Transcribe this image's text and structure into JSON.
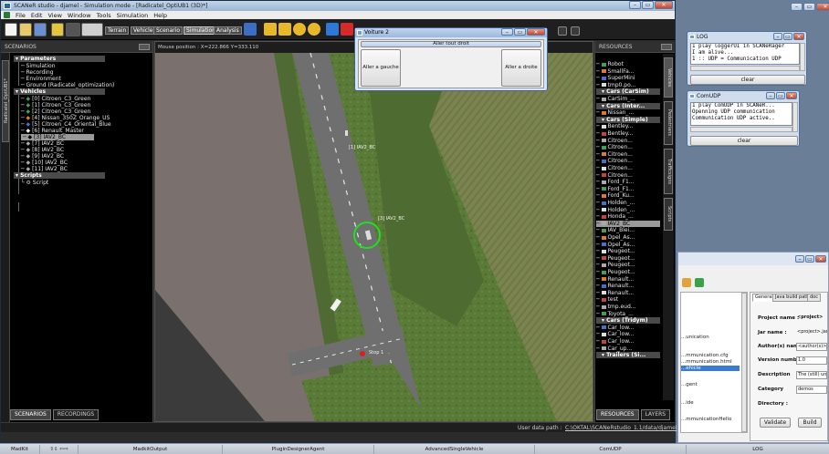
{
  "main_window": {
    "title": "SCANeR studio - djamel - Simulation mode - [Radicatel_OptiUB1 (3D)*]",
    "controls": [
      "–",
      "▭",
      "✕"
    ]
  },
  "menu": [
    "File",
    "Edit",
    "View",
    "Window",
    "Tools",
    "Simulation",
    "Help"
  ],
  "toolbar": {
    "modes": [
      "Terrain",
      "Vehicle",
      "Scenario",
      "Simulation",
      "Analysis"
    ],
    "active_mode": "Simulation"
  },
  "scenarios_panel": {
    "title": "SCENARIOS",
    "side_tab": "Radicatel_OptiUB1*",
    "tree": {
      "parameters": {
        "label": "Parameters",
        "children": [
          "Simulation",
          "Recording",
          "Environment",
          "Ground (Radicatel_optimization)"
        ]
      },
      "vehicles": {
        "label": "Vehicles",
        "children": [
          "[0] Citroen_C3_Green",
          "[1] Citroen_C3_Green",
          "[2] Citroen_C3_Green",
          "[4] Nissan_350Z_Orange_US",
          "[5] Citroen_C4_Oriental_Blue",
          "[6] Renault_Master",
          "[3] IAV2_BC",
          "[7] IAV2_BC",
          "[8] IAV2_BC",
          "[9] IAV2_BC",
          "[10] IAV2_BC",
          "[11] IAV2_BC"
        ],
        "selected": "[3] IAV2_BC"
      },
      "scripts": {
        "label": "Scripts",
        "children": [
          "Script"
        ]
      }
    },
    "bottom_tabs": [
      "SCENARIOS",
      "RECORDINGS"
    ]
  },
  "viewport": {
    "mouse_position": "Mouse position :  X=222.866    Y=333.110",
    "labels": {
      "iav2_a": "[1] IAV2_BC",
      "iav2_b": "[3] IAV2_BC",
      "stop": "Stop 1"
    }
  },
  "voiture_dialog": {
    "title": "Voiture 2",
    "btn_straight": "Aller tout droit",
    "btn_left": "Aller a gauche",
    "btn_right": "Aller a droite"
  },
  "resources_panel": {
    "title": "RESOURCES",
    "items": [
      {
        "type": "item",
        "label": "Robot"
      },
      {
        "type": "item",
        "label": "SmallFa..."
      },
      {
        "type": "item",
        "label": "SuperMini"
      },
      {
        "type": "item",
        "label": "tmp0.po..."
      },
      {
        "type": "group",
        "label": "Cars (CarSim)"
      },
      {
        "type": "item",
        "label": "CarSim_..."
      },
      {
        "type": "group",
        "label": "Cars (Inter..."
      },
      {
        "type": "item",
        "label": "Nissan_..."
      },
      {
        "type": "group",
        "label": "Cars (Simple)"
      },
      {
        "type": "item",
        "label": "Bentley..."
      },
      {
        "type": "item",
        "label": "Bentley..."
      },
      {
        "type": "item",
        "label": "Citroen..."
      },
      {
        "type": "item",
        "label": "Citroen..."
      },
      {
        "type": "item",
        "label": "Citroen..."
      },
      {
        "type": "item",
        "label": "Citroen..."
      },
      {
        "type": "item",
        "label": "Citroen..."
      },
      {
        "type": "item",
        "label": "Citroen..."
      },
      {
        "type": "item",
        "label": "Ford_F1..."
      },
      {
        "type": "item",
        "label": "Ford_F1..."
      },
      {
        "type": "item",
        "label": "Ford_Ku..."
      },
      {
        "type": "item",
        "label": "Holden_..."
      },
      {
        "type": "item",
        "label": "Holden_..."
      },
      {
        "type": "item",
        "label": "Honda_..."
      },
      {
        "type": "item",
        "label": "IAV2_BC",
        "selected": true
      },
      {
        "type": "item",
        "label": "IAV_Blei..."
      },
      {
        "type": "item",
        "label": "Opel_As..."
      },
      {
        "type": "item",
        "label": "Opel_As..."
      },
      {
        "type": "item",
        "label": "Peugeot..."
      },
      {
        "type": "item",
        "label": "Peugeot..."
      },
      {
        "type": "item",
        "label": "Peugeot..."
      },
      {
        "type": "item",
        "label": "Peugeot..."
      },
      {
        "type": "item",
        "label": "Renault..."
      },
      {
        "type": "item",
        "label": "Renault..."
      },
      {
        "type": "item",
        "label": "Renault..."
      },
      {
        "type": "item",
        "label": "test"
      },
      {
        "type": "item",
        "label": "tmp.eud..."
      },
      {
        "type": "item",
        "label": "Toyota_..."
      },
      {
        "type": "group",
        "label": "Cars (Tridym)"
      },
      {
        "type": "item",
        "label": "Car_low..."
      },
      {
        "type": "item",
        "label": "Car_low..."
      },
      {
        "type": "item",
        "label": "Car_low..."
      },
      {
        "type": "item",
        "label": "Car_up..."
      },
      {
        "type": "group",
        "label": "Trailers (Si..."
      }
    ],
    "vtabs": [
      "Vehicles",
      "Pedestrians",
      "Trafficsigns",
      "Scripts"
    ],
    "bottom_tabs": [
      "RESOURCES",
      "LAYERS"
    ]
  },
  "statusbar": {
    "label": "User data path :",
    "path": "C:\\OKTAL\\SCANeRstudio_1.1/data/djamel"
  },
  "log_window": {
    "title": "LOG",
    "lines": [
      "1 play loggerUI in SCANeRager",
      "I am alive...",
      "1 :: UDP = Communication UDP"
    ],
    "clear": "clear"
  },
  "comudp_window": {
    "title": "ComUDP",
    "lines": [
      "1 play ComUDP in SCANeR...",
      "Openning UDP communication",
      "Communication UDP active.."
    ],
    "clear": "clear"
  },
  "plugin_designer": {
    "tabs": [
      "General",
      "Java build path",
      "doc"
    ],
    "tree_items": [
      "...unication",
      "...mmunication.cfg",
      "...mmunication.html",
      "...ehicle",
      "...gent",
      "...ide",
      "...mmunicationHello"
    ],
    "fields": {
      "project_name_label": "Project name :",
      "project_name_value": "<project>",
      "jar_name_label": "Jar name :",
      "jar_name_value": "<project>.jar",
      "authors_label": "Author(s) name :",
      "authors_value": "<author(s)>",
      "version_label": "Version number :",
      "version_value": "1.0",
      "description_label": "Description",
      "description_value": "The (still) unk",
      "category_label": "Category",
      "category_value": "demos",
      "directory_label": "Directory :"
    },
    "validate": "Validate",
    "build": "Build"
  },
  "taskbar": {
    "items": [
      "MadKit",
      "MadkitOutput",
      "PluginDesignerAgent",
      "AdvancedSingleVehicle",
      "ComUDP",
      "LOG"
    ],
    "nav_arrows": "⇧⇩ ⇦⇨"
  },
  "colors": {
    "accent_selection": "#9a9a9a",
    "circle_highlight": "#22dd22",
    "grass": "#5f7a3c",
    "road": "#6c6c6c"
  }
}
